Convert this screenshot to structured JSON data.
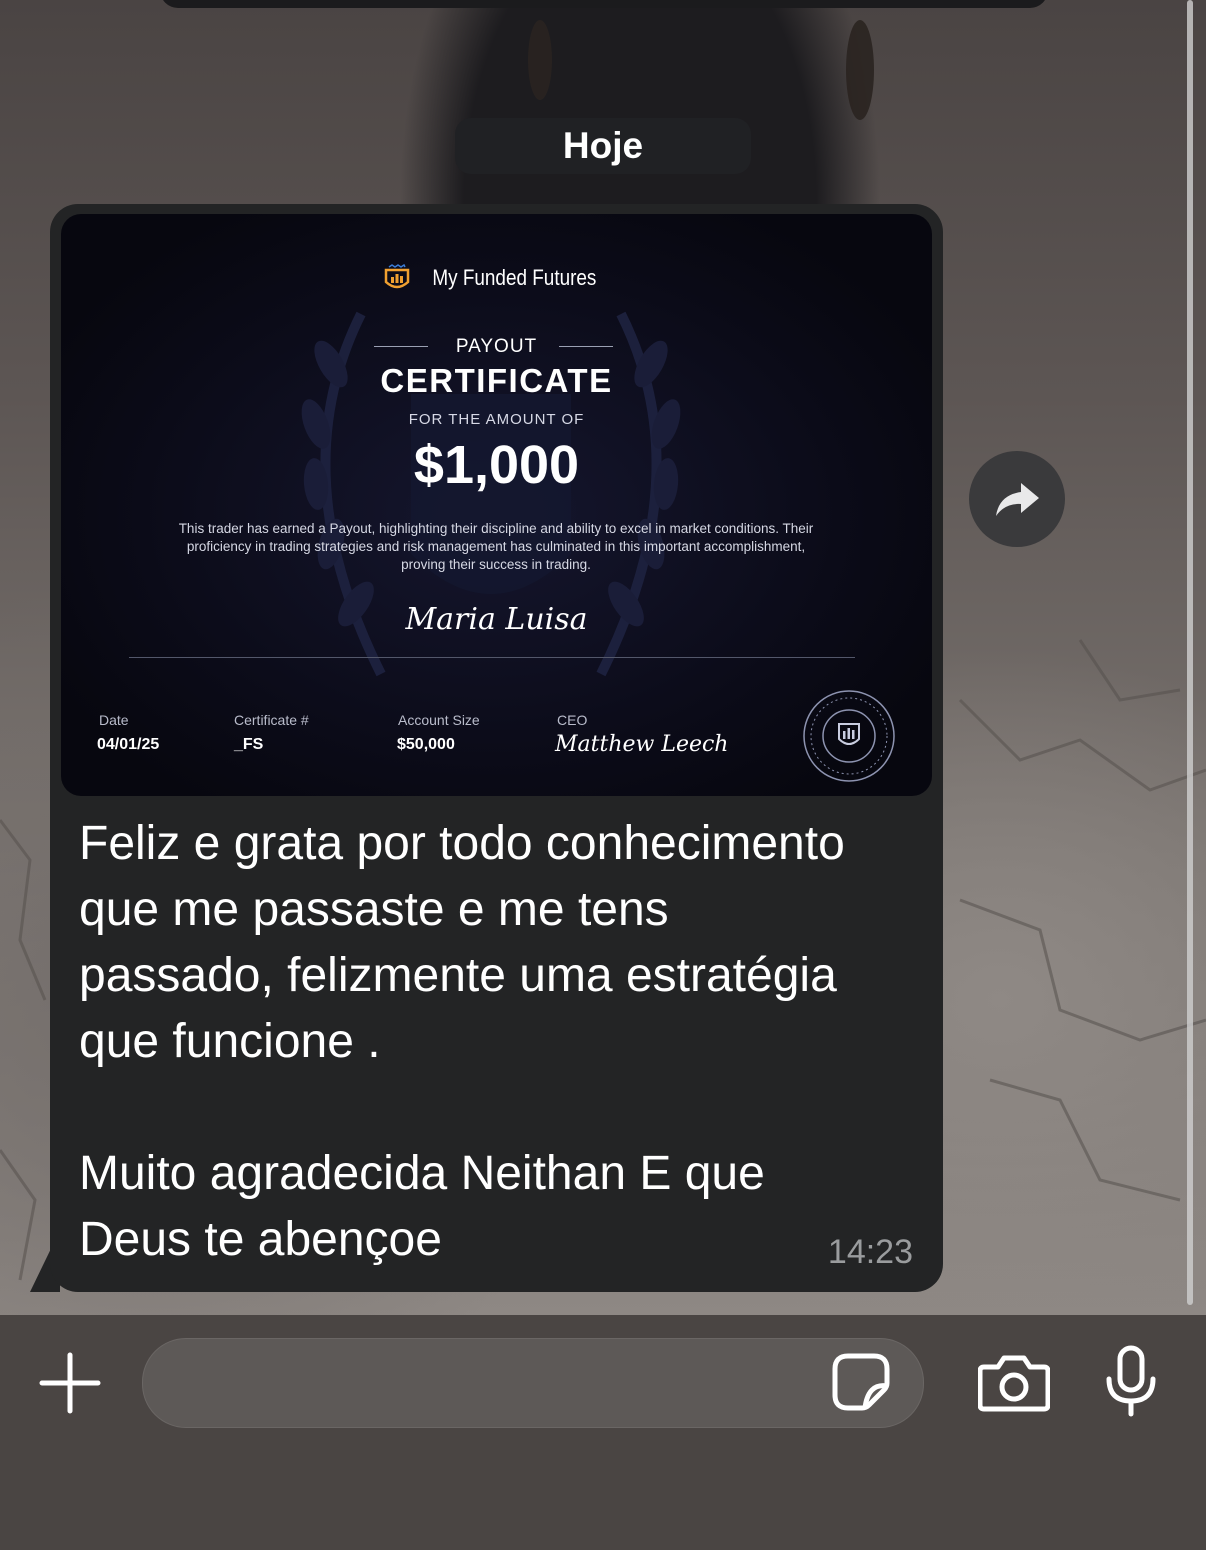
{
  "chat": {
    "date_separator": "Hoje"
  },
  "message": {
    "certificate": {
      "brand": "My Funded Futures",
      "eyebrow": "PAYOUT",
      "title": "CERTIFICATE",
      "subtitle": "FOR THE AMOUNT OF",
      "amount": "$1,000",
      "body": "This trader has earned a Payout, highlighting their discipline and ability to excel in market conditions. Their proficiency in trading strategies and risk management has culminated in this important accomplishment, proving their success in trading.",
      "recipient_signature": "Maria Luisa",
      "fields": [
        {
          "label": "Date",
          "value": "04/01/25"
        },
        {
          "label": "Certificate #",
          "value": "_FS"
        },
        {
          "label": "Account Size",
          "value": "$50,000"
        },
        {
          "label": "CEO",
          "value": "Matthew Leech"
        }
      ]
    },
    "text": "Feliz e grata por todo conhecimento\nque me passaste e me tens\npassado, felizmente uma estratégia\nque funcione .\n\nMuito agradecida Neithan E que\nDeus te abençoe",
    "time": "14:23"
  },
  "composer": {
    "input_value": "",
    "icons": [
      "plus-icon",
      "sticker-icon",
      "camera-icon",
      "microphone-icon"
    ]
  },
  "colors": {
    "bubble": "#232425",
    "composer": "#4a4543",
    "certificate_bg": "#0b0b18"
  }
}
